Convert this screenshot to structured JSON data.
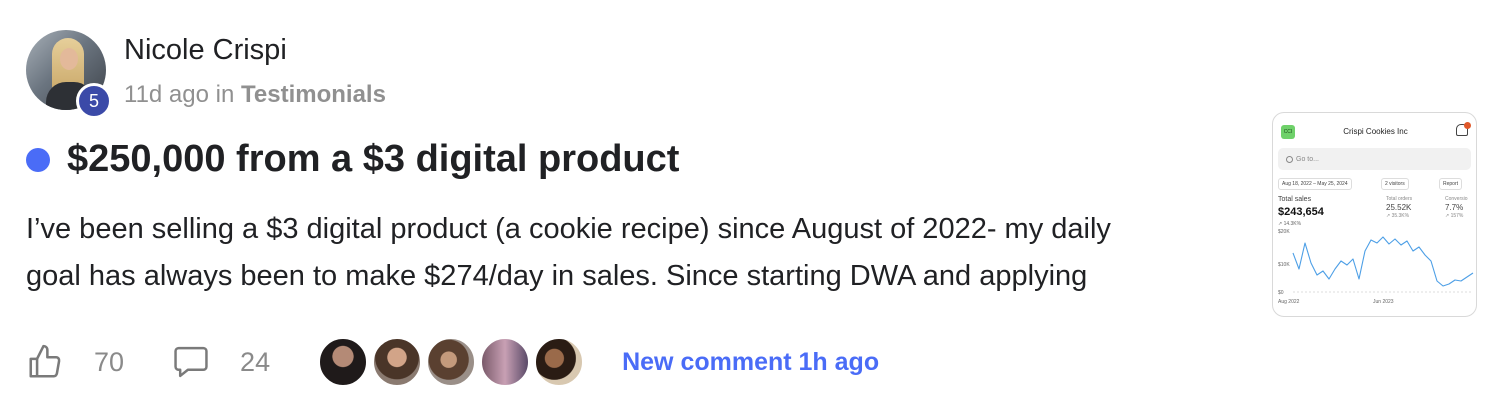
{
  "author": {
    "name": "Nicole Crispi",
    "level": "5"
  },
  "meta": {
    "time": "11d ago",
    "connector": "in",
    "category": "Testimonials"
  },
  "post": {
    "title": "$250,000 from a $3 digital product",
    "body_line1": "I’ve been selling a $3 digital product (a cookie recipe) since August of 2022- my daily",
    "body_line2": "goal has always been to make $274/day in sales. Since starting DWA and applying"
  },
  "actions": {
    "likes": "70",
    "comments": "24",
    "new_comment": "New comment 1h ago"
  },
  "colors": {
    "accent": "#4a6cf7",
    "level_badge": "#3b4aa8"
  },
  "thumbnail": {
    "logo": "CCI",
    "shop_name": "Crispi Cookies Inc",
    "search_placeholder": "Go to...",
    "date_range": "Aug 18, 2022 – May 25, 2024",
    "visitors": "2 visitors",
    "report": "Report",
    "total_sales_label": "Total sales",
    "total_sales_value": "$243,654",
    "total_sales_change": "↗ 14.3K%",
    "total_orders_label": "Total orders",
    "total_orders_value": "25.52K",
    "total_orders_change": "↗ 35.3K%",
    "conversion_label": "Conversio",
    "conversion_value": "7.7%",
    "conversion_change": "↗ 157%",
    "y_top": "$20K",
    "y_mid": "$10K",
    "y_zero": "$0",
    "x_start": "Aug 2022",
    "x_end": "Jun 2023"
  }
}
